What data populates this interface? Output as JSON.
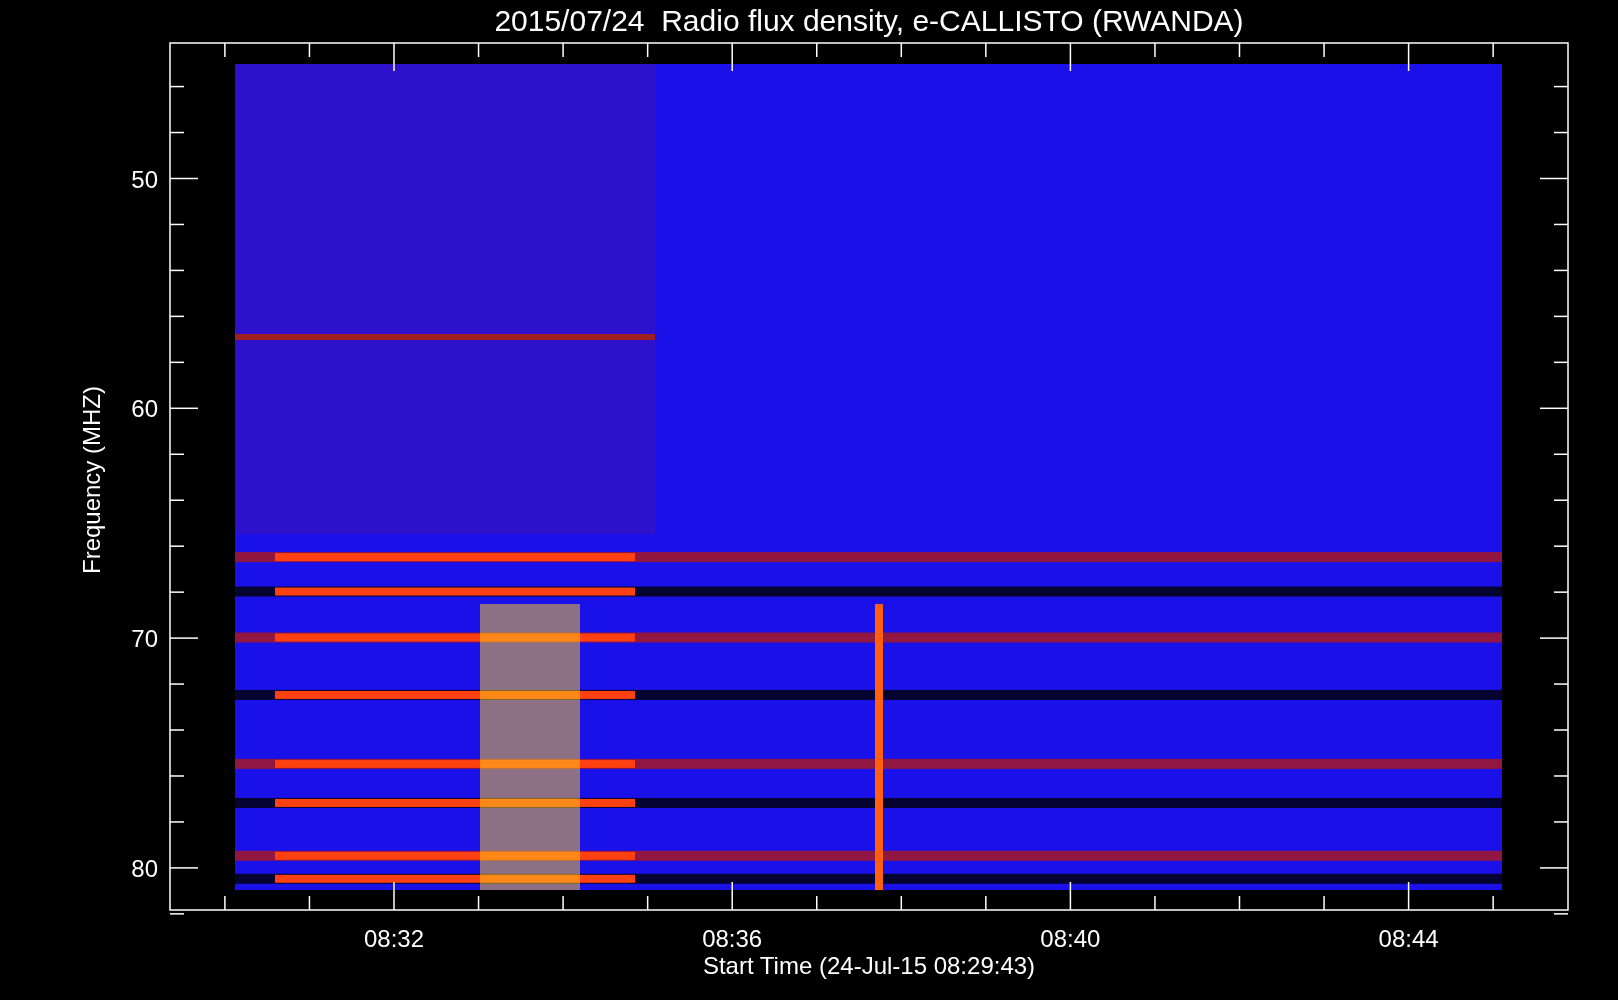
{
  "title": "2015/07/24  Radio flux density, e-CALLISTO (RWANDA)",
  "y_axis": {
    "label": "Frequency (MHZ)",
    "ticks": [
      "50",
      "60",
      "70",
      "80"
    ]
  },
  "x_axis": {
    "label": "Start Time (24-Jul-15 08:29:43)",
    "ticks": [
      "08:32",
      "08:36",
      "08:40",
      "08:44"
    ]
  }
}
